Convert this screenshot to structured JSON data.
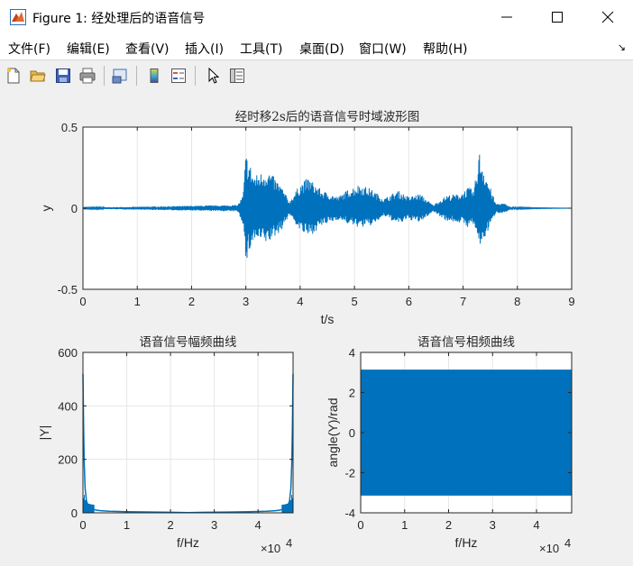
{
  "window": {
    "title": "Figure 1: 经处理后的语音信号",
    "buttons": [
      "minimize",
      "maximize",
      "close"
    ]
  },
  "menu": [
    "文件(F)",
    "编辑(E)",
    "查看(V)",
    "插入(I)",
    "工具(T)",
    "桌面(D)",
    "窗口(W)",
    "帮助(H)"
  ],
  "toolbar": {
    "icons": [
      "new-figure-icon",
      "open-file-icon",
      "save-icon",
      "print-icon",
      "link-plot-icon",
      "colorbar-icon",
      "legend-icon",
      "pointer-icon",
      "property-editor-icon"
    ]
  },
  "colors": {
    "line": "#0072bd",
    "axes": "#262626",
    "grid": "#e6e6e6",
    "figure_bg": "#f0f0f0"
  },
  "chart_data": [
    {
      "type": "line",
      "title": "经时移2s后的语音信号时域波形图",
      "xlabel": "t/s",
      "ylabel": "y",
      "xlim": [
        0,
        9
      ],
      "ylim": [
        -0.5,
        0.5
      ],
      "xticks": [
        "0",
        "1",
        "2",
        "3",
        "4",
        "5",
        "6",
        "7",
        "8",
        "9"
      ],
      "yticks": [
        "-0.5",
        "0",
        "0.5"
      ],
      "grid": true,
      "envelope": {
        "x": [
          0,
          2.85,
          2.95,
          3.0,
          3.05,
          3.15,
          3.4,
          3.65,
          3.8,
          4.0,
          4.15,
          4.4,
          4.7,
          4.9,
          5.1,
          5.3,
          5.55,
          5.8,
          6.0,
          6.2,
          6.45,
          6.7,
          6.95,
          7.1,
          7.2,
          7.3,
          7.45,
          7.6,
          7.75,
          7.9,
          8.35,
          9
        ],
        "upper": [
          0.003,
          0.02,
          0.08,
          0.34,
          0.3,
          0.2,
          0.24,
          0.14,
          0.04,
          0.15,
          0.19,
          0.11,
          0.07,
          0.12,
          0.15,
          0.12,
          0.06,
          0.11,
          0.07,
          0.09,
          0.02,
          0.08,
          0.09,
          0.13,
          0.11,
          0.35,
          0.18,
          0.03,
          0.03,
          0.005,
          0.002,
          0
        ],
        "lower": [
          -0.003,
          -0.02,
          -0.1,
          -0.37,
          -0.28,
          -0.2,
          -0.22,
          -0.14,
          -0.04,
          -0.14,
          -0.18,
          -0.11,
          -0.07,
          -0.1,
          -0.12,
          -0.11,
          -0.05,
          -0.1,
          -0.07,
          -0.09,
          -0.02,
          -0.08,
          -0.09,
          -0.12,
          -0.1,
          -0.25,
          -0.15,
          -0.03,
          -0.03,
          -0.005,
          -0.002,
          0
        ]
      }
    },
    {
      "type": "line",
      "title": "语音信号幅频曲线",
      "xlabel": "f/Hz",
      "ylabel": "|Y|",
      "xlim": [
        0,
        48000
      ],
      "ylim": [
        0,
        600
      ],
      "xticks": [
        "0",
        "1",
        "2",
        "3",
        "4"
      ],
      "yticks": [
        "0",
        "200",
        "400",
        "600"
      ],
      "x_multiplier": "×10",
      "x_multiplier_exp": "4",
      "grid": true,
      "peak_value": 520,
      "x": [
        0,
        150,
        300,
        500,
        800,
        1200,
        1700,
        2300,
        3000,
        4000,
        6000,
        10000,
        20000,
        24000,
        28000,
        38000,
        42000,
        44000,
        45000,
        45700,
        46300,
        46800,
        47200,
        47500,
        47700,
        47850,
        48000
      ],
      "y": [
        520,
        320,
        180,
        90,
        45,
        25,
        18,
        14,
        10,
        8,
        6,
        4,
        2,
        1,
        2,
        4,
        6,
        8,
        10,
        14,
        18,
        25,
        45,
        90,
        180,
        320,
        520
      ]
    },
    {
      "type": "area",
      "title": "语音信号相频曲线",
      "xlabel": "f/Hz",
      "ylabel": "angle(Y)/rad",
      "xlim": [
        0,
        48000
      ],
      "ylim": [
        -4,
        4
      ],
      "xticks": [
        "0",
        "1",
        "2",
        "3",
        "4"
      ],
      "yticks": [
        "-4",
        "-2",
        "0",
        "2",
        "4"
      ],
      "x_multiplier": "×10",
      "x_multiplier_exp": "4",
      "grid": true,
      "band": [
        -3.1416,
        3.1416
      ]
    }
  ]
}
